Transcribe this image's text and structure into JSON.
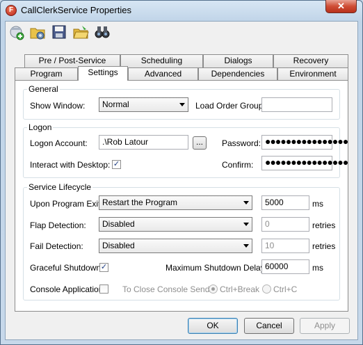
{
  "window": {
    "title": "CallClerkService Properties",
    "close_glyph": "✕",
    "app_icon_letter": "F"
  },
  "toolbar": {
    "icons": [
      "add-icon",
      "settings-folder-icon",
      "save-icon",
      "open-folder-icon",
      "binoculars-icon"
    ]
  },
  "tabs": {
    "row1": [
      "Pre / Post-Service",
      "Scheduling",
      "Dialogs",
      "Recovery"
    ],
    "row2": [
      "Program",
      "Settings",
      "Advanced",
      "Dependencies",
      "Environment"
    ],
    "active": "Settings"
  },
  "general": {
    "title": "General",
    "show_window_label": "Show Window:",
    "show_window_value": "Normal",
    "load_order_label": "Load Order Group:",
    "load_order_value": ""
  },
  "logon": {
    "title": "Logon",
    "account_label": "Logon Account:",
    "account_value": ".\\Rob Latour",
    "browse_label": "...",
    "password_label": "Password:",
    "password_value": "●●●●●●●●●●●●●●●●",
    "interact_label": "Interact with Desktop:",
    "interact_checked": "✓",
    "confirm_label": "Confirm:",
    "confirm_value": "●●●●●●●●●●●●●●●●"
  },
  "lifecycle": {
    "title": "Service Lifecycle",
    "exit_label": "Upon Program Exit:",
    "exit_value": "Restart the Program",
    "exit_delay": "5000",
    "exit_unit": "ms",
    "flap_label": "Flap Detection:",
    "flap_value": "Disabled",
    "flap_retries": "0",
    "flap_unit": "retries",
    "fail_label": "Fail Detection:",
    "fail_value": "Disabled",
    "fail_retries": "10",
    "fail_unit": "retries",
    "graceful_label": "Graceful Shutdown:",
    "graceful_checked": "✓",
    "max_delay_label": "Maximum Shutdown Delay:",
    "max_delay_value": "60000",
    "max_delay_unit": "ms",
    "console_label": "Console Application:",
    "close_send_label": "To Close Console Send:",
    "ctrl_break": "Ctrl+Break",
    "ctrl_c": "Ctrl+C"
  },
  "buttons": {
    "ok": "OK",
    "cancel": "Cancel",
    "apply": "Apply"
  }
}
